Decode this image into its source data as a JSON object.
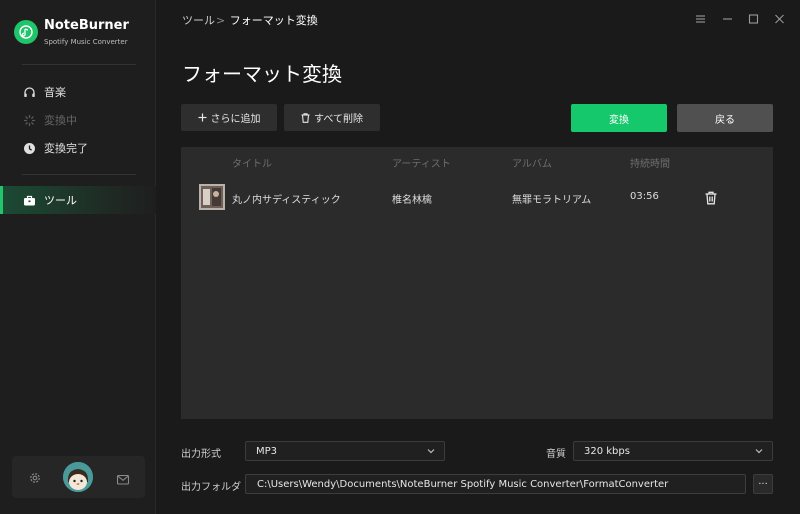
{
  "app": {
    "name": "NoteBurner",
    "subtitle": "Spotify Music Converter",
    "accent_color": "#16c86c"
  },
  "sidebar": {
    "items": [
      {
        "label": "音楽",
        "icon": "headphones-icon",
        "state": "normal"
      },
      {
        "label": "変換中",
        "icon": "loading-icon",
        "state": "disabled"
      },
      {
        "label": "変換完了",
        "icon": "clock-icon",
        "state": "normal"
      },
      {
        "label": "ツール",
        "icon": "toolbox-icon",
        "state": "active"
      }
    ],
    "footer": {
      "settings_icon": "gear-icon",
      "avatar": "avatar",
      "mail_icon": "mail-icon"
    }
  },
  "header": {
    "breadcrumb_parent": "ツール",
    "breadcrumb_separator": ">",
    "breadcrumb_current": "フォーマット変換",
    "window_controls": [
      "menu-icon",
      "minimize-icon",
      "maximize-icon",
      "close-icon"
    ]
  },
  "main": {
    "title": "フォーマット変換",
    "toolbar": {
      "add_label": "さらに追加",
      "delete_all_label": "すべて削除",
      "convert_label": "変換",
      "back_label": "戻る"
    },
    "table": {
      "columns": [
        "タイトル",
        "アーティスト",
        "アルバム",
        "持続時間"
      ],
      "rows": [
        {
          "title": "丸ノ内サディスティック",
          "artist": "椎名林檎",
          "album": "無罪モラトリアム",
          "duration": "03:56"
        }
      ]
    },
    "output": {
      "format_label": "出力形式",
      "format_value": "MP3",
      "quality_label": "音質",
      "quality_value": "320 kbps",
      "folder_label": "出力フォルダ",
      "folder_value": "C:\\Users\\Wendy\\Documents\\NoteBurner Spotify Music Converter\\FormatConverter",
      "browse_label": "···"
    }
  }
}
